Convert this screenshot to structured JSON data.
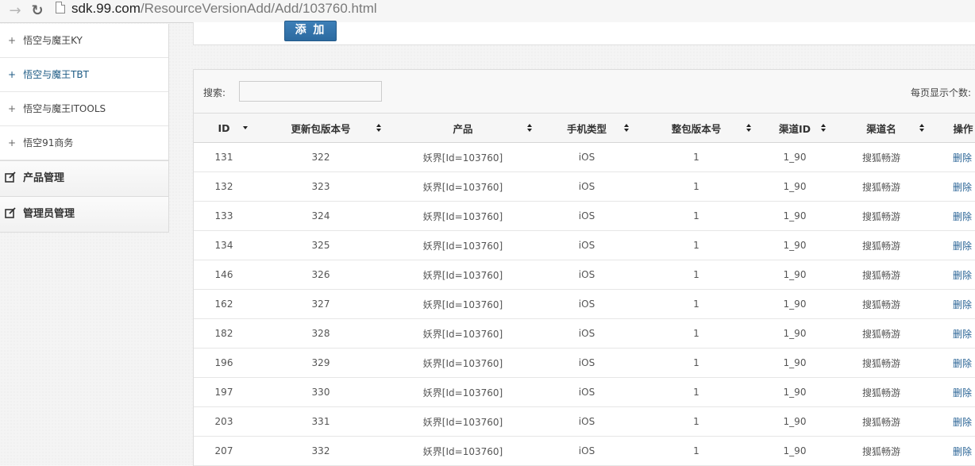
{
  "browser": {
    "url_host": "sdk.99.com",
    "url_path": "/ResourceVersionAdd/Add/103760.html"
  },
  "sidebar": {
    "items": [
      {
        "label": "悟空与魔王KY",
        "active": false
      },
      {
        "label": "悟空与魔王TBT",
        "active": true
      },
      {
        "label": "悟空与魔王ITOOLS",
        "active": false
      },
      {
        "label": "悟空91商务",
        "active": false
      }
    ],
    "plus_symbol": "+",
    "groups": [
      {
        "label": "产品管理",
        "icon": "edit-icon"
      },
      {
        "label": "管理员管理",
        "icon": "edit-icon"
      }
    ]
  },
  "top": {
    "add_label": "添 加"
  },
  "table": {
    "search_label": "搜索:",
    "search_value": "",
    "per_page_label": "每页显示个数:",
    "columns": [
      "ID",
      "更新包版本号",
      "产品",
      "手机类型",
      "整包版本号",
      "渠道ID",
      "渠道名",
      "操作"
    ],
    "rows": [
      [
        "131",
        "322",
        "妖界[Id=103760]",
        "iOS",
        "1",
        "1_90",
        "搜狐畅游",
        "删除"
      ],
      [
        "132",
        "323",
        "妖界[Id=103760]",
        "iOS",
        "1",
        "1_90",
        "搜狐畅游",
        "删除"
      ],
      [
        "133",
        "324",
        "妖界[Id=103760]",
        "iOS",
        "1",
        "1_90",
        "搜狐畅游",
        "删除"
      ],
      [
        "134",
        "325",
        "妖界[Id=103760]",
        "iOS",
        "1",
        "1_90",
        "搜狐畅游",
        "删除"
      ],
      [
        "146",
        "326",
        "妖界[Id=103760]",
        "iOS",
        "1",
        "1_90",
        "搜狐畅游",
        "删除"
      ],
      [
        "162",
        "327",
        "妖界[Id=103760]",
        "iOS",
        "1",
        "1_90",
        "搜狐畅游",
        "删除"
      ],
      [
        "182",
        "328",
        "妖界[Id=103760]",
        "iOS",
        "1",
        "1_90",
        "搜狐畅游",
        "删除"
      ],
      [
        "196",
        "329",
        "妖界[Id=103760]",
        "iOS",
        "1",
        "1_90",
        "搜狐畅游",
        "删除"
      ],
      [
        "197",
        "330",
        "妖界[Id=103760]",
        "iOS",
        "1",
        "1_90",
        "搜狐畅游",
        "删除"
      ],
      [
        "203",
        "331",
        "妖界[Id=103760]",
        "iOS",
        "1",
        "1_90",
        "搜狐畅游",
        "删除"
      ],
      [
        "207",
        "332",
        "妖界[Id=103760]",
        "iOS",
        "1",
        "1_90",
        "搜狐畅游",
        "删除"
      ]
    ]
  },
  "colors": {
    "accent": "#2c6aa0",
    "active_link": "#1c5a84"
  }
}
